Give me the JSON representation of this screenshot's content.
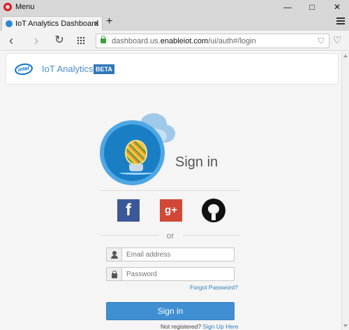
{
  "window": {
    "menu_label": "Menu",
    "minimize": "—",
    "maximize": "□",
    "close": "✕"
  },
  "tab": {
    "title": "IoT Analytics Dashboard",
    "close": "×",
    "new_tab": "+"
  },
  "address": {
    "url_prefix": "dashboard.us.",
    "url_domain": "enableiot.com",
    "url_path": "/ui/auth#/login"
  },
  "header": {
    "brand": "intel",
    "app_title": "IoT Analytics",
    "badge": "BETA"
  },
  "signin": {
    "title": "Sign in",
    "facebook": "f",
    "google": "g+",
    "or": "or",
    "email_placeholder": "Email address",
    "password_placeholder": "Password",
    "forgot": "Forgot Password?",
    "button": "Sign in",
    "not_registered": "Not registered? ",
    "signup": "Sign Up Here"
  },
  "colors": {
    "primary": "#3f8fd2",
    "facebook": "#3b5998",
    "google": "#d14836",
    "link": "#2a7fbf"
  }
}
